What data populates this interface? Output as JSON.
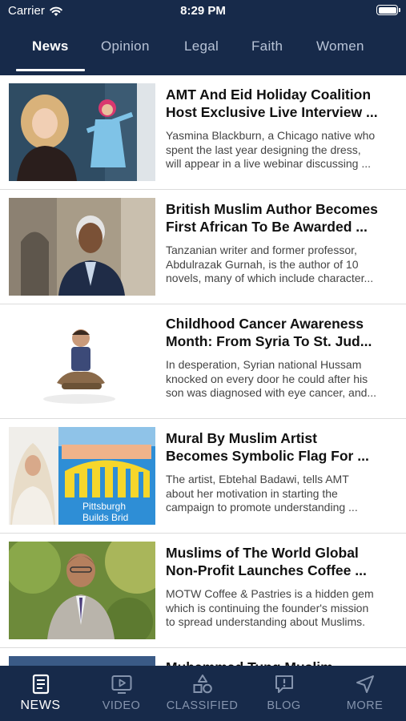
{
  "status_bar": {
    "carrier": "Carrier",
    "time": "8:29 PM",
    "icons": [
      "wifi-icon",
      "battery-icon"
    ]
  },
  "top_tabs": [
    {
      "label": "News",
      "active": true
    },
    {
      "label": "Opinion",
      "active": false
    },
    {
      "label": "Legal",
      "active": false
    },
    {
      "label": "Faith",
      "active": false
    },
    {
      "label": "Women",
      "active": false
    }
  ],
  "articles": [
    {
      "title": "AMT And Eid Holiday Coalition\nHost Exclusive Live Interview ...",
      "description": "Yasmina Blackburn, a Chicago native who\nspent the last year designing the dress,\nwill appear in a live webinar discussing ..."
    },
    {
      "title": "British Muslim Author Becomes\nFirst African To Be Awarded ...",
      "description": "Tanzanian writer and former professor,\nAbdulrazak Gurnah, is the author of 10\nnovels, many of which include character..."
    },
    {
      "title": "Childhood Cancer Awareness\nMonth: From Syria To St. Jud...",
      "description": "In desperation, Syrian national Hussam\nknocked on every door he could after his\nson was diagnosed with eye cancer, and..."
    },
    {
      "title": "Mural By Muslim Artist\nBecomes Symbolic Flag For ...",
      "description": "The artist, Ebtehal Badawi, tells AMT\nabout her motivation in starting the\ncampaign to promote understanding ...",
      "image_text": [
        "Pittsburgh",
        "Builds Brid"
      ]
    },
    {
      "title": "Muslims of The World Global\nNon-Profit Launches Coffee ...",
      "description": "MOTW Coffee & Pastries is a hidden gem\nwhich is continuing the founder's mission\nto spread understanding about Muslims."
    },
    {
      "title": "Muhammad Tung Muslim"
    }
  ],
  "bottom_nav": [
    {
      "label": "NEWS",
      "icon": "news-icon",
      "active": true
    },
    {
      "label": "VIDEO",
      "icon": "video-icon",
      "active": false
    },
    {
      "label": "CLASSIFIED",
      "icon": "classified-icon",
      "active": false
    },
    {
      "label": "BLOG",
      "icon": "blog-icon",
      "active": false
    },
    {
      "label": "MORE",
      "icon": "location-arrow-icon",
      "active": false
    }
  ],
  "colors": {
    "header_bg": "#172a4a",
    "tab_active": "#ffffff",
    "tab_inactive": "#b8c3d6",
    "nav_inactive": "#8594ad"
  }
}
